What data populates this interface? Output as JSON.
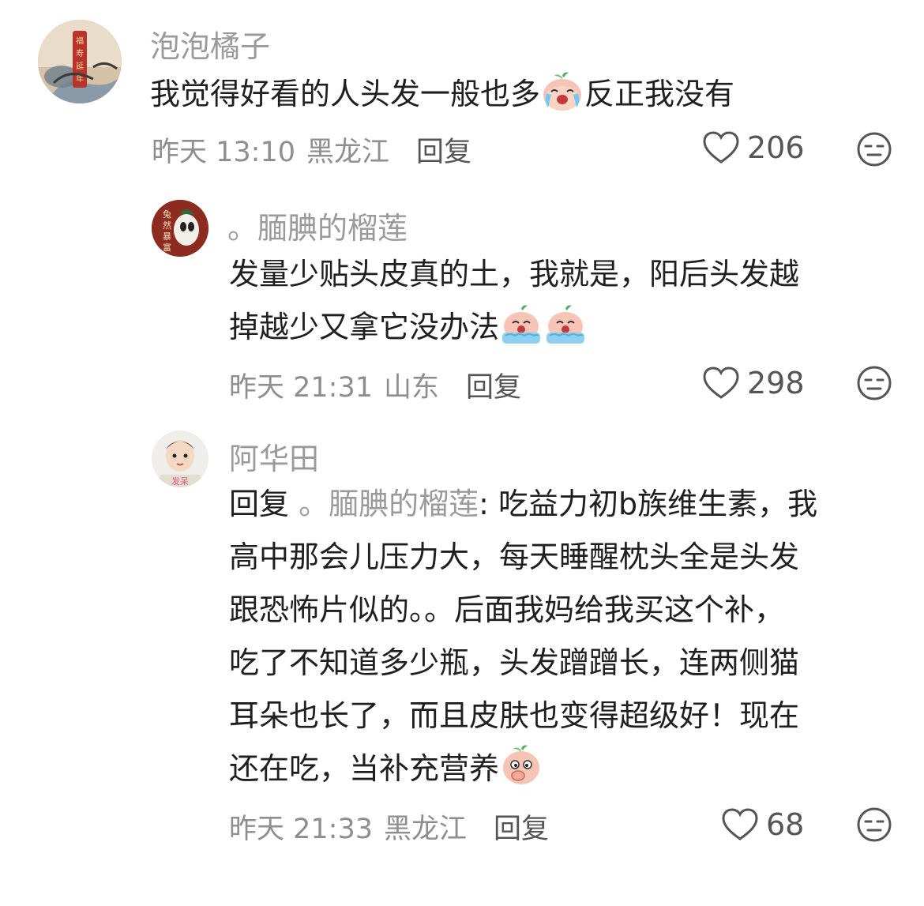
{
  "comments": [
    {
      "username": "泡泡橘子",
      "avatar_text": "福寿延年",
      "content_lines": [
        "我觉得好看的人头发一般也多",
        "反正我没有"
      ],
      "content_emoji": "crying-peach-emoji",
      "time": "昨天 13:10",
      "location": "黑龙江",
      "reply_label": "回复",
      "likes": "206"
    },
    {
      "username": "。腼腆的榴莲",
      "avatar_text": "兔然暴富",
      "content_lines": [
        "发量少贴头皮真的土，我就是，阳后头发越",
        "掉越少又拿它没办法"
      ],
      "content_emoji": "crying-peach-emoji",
      "time": "昨天 21:31",
      "location": "山东",
      "reply_label": "回复",
      "likes": "298"
    },
    {
      "username": "阿华田",
      "avatar_text": "发呆",
      "reply_prefix": "回复",
      "reply_to": "。腼腆的榴莲",
      "content_lines": [
        ": 吃益力初b族维生素，我",
        "高中那会儿压力大，每天睡醒枕头全是头发",
        "跟恐怖片似的。。后面我妈给我买这个补，",
        "吃了不知道多少瓶，头发蹭蹭长，连两侧猫",
        "耳朵也长了，而且皮肤也变得超级好！现在",
        "还在吃，当补充营养"
      ],
      "content_emoji": "thinking-peach-emoji",
      "time": "昨天 21:33",
      "location": "黑龙江",
      "reply_label": "回复",
      "likes": "68"
    }
  ],
  "colors": {
    "username": "#9a9a9a",
    "text": "#1f1f1f",
    "meta": "#8e8e8e",
    "icon": "#555555"
  }
}
